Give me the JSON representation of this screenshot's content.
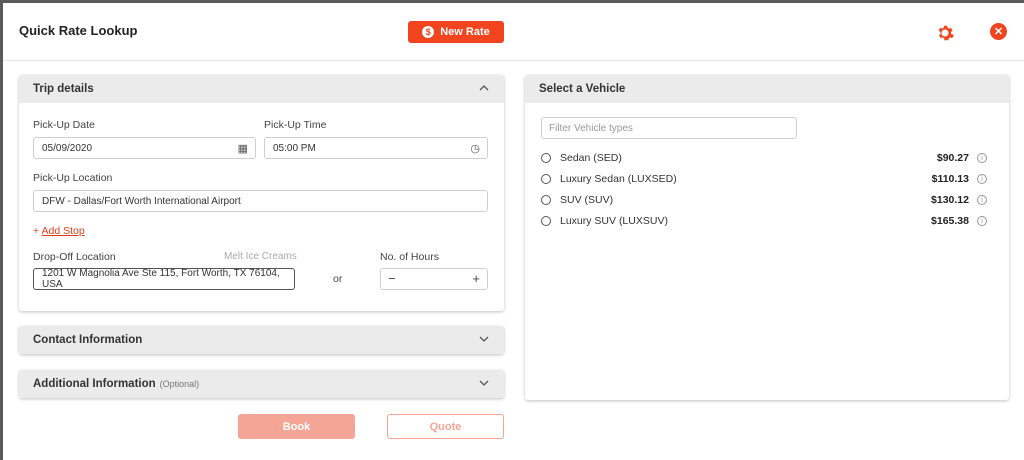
{
  "header": {
    "title": "Quick Rate Lookup",
    "new_rate_label": "New Rate",
    "new_rate_icon": "$"
  },
  "trip": {
    "title": "Trip details",
    "pickup_date_label": "Pick-Up Date",
    "pickup_date_value": "05/09/2020",
    "pickup_time_label": "Pick-Up Time",
    "pickup_time_value": "05:00 PM",
    "pickup_location_label": "Pick-Up Location",
    "pickup_location_value": "DFW - Dallas/Fort Worth International Airport",
    "add_stop_label": "Add Stop",
    "dropoff_label": "Drop-Off Location",
    "dropoff_hint": "Melt Ice Creams",
    "dropoff_value": "1201 W Magnolia Ave Ste 115, Fort Worth, TX 76104, USA",
    "or_label": "or",
    "hours_label": "No. of Hours"
  },
  "contact": {
    "title": "Contact Information"
  },
  "additional": {
    "title": "Additional Information",
    "optional": "(Optional)"
  },
  "vehicle": {
    "title": "Select a Vehicle",
    "filter_placeholder": "Filter Vehicle types",
    "options": [
      {
        "name": "Sedan (SED)",
        "price": "$90.27"
      },
      {
        "name": "Luxury Sedan (LUXSED)",
        "price": "$110.13"
      },
      {
        "name": "SUV (SUV)",
        "price": "$130.12"
      },
      {
        "name": "Luxury SUV (LUXSUV)",
        "price": "$165.38"
      }
    ]
  },
  "actions": {
    "book_label": "Book",
    "quote_label": "Quote"
  },
  "colors": {
    "accent": "#f0451f",
    "disabled_accent": "#f4a595",
    "panel_header": "#ebebeb"
  }
}
